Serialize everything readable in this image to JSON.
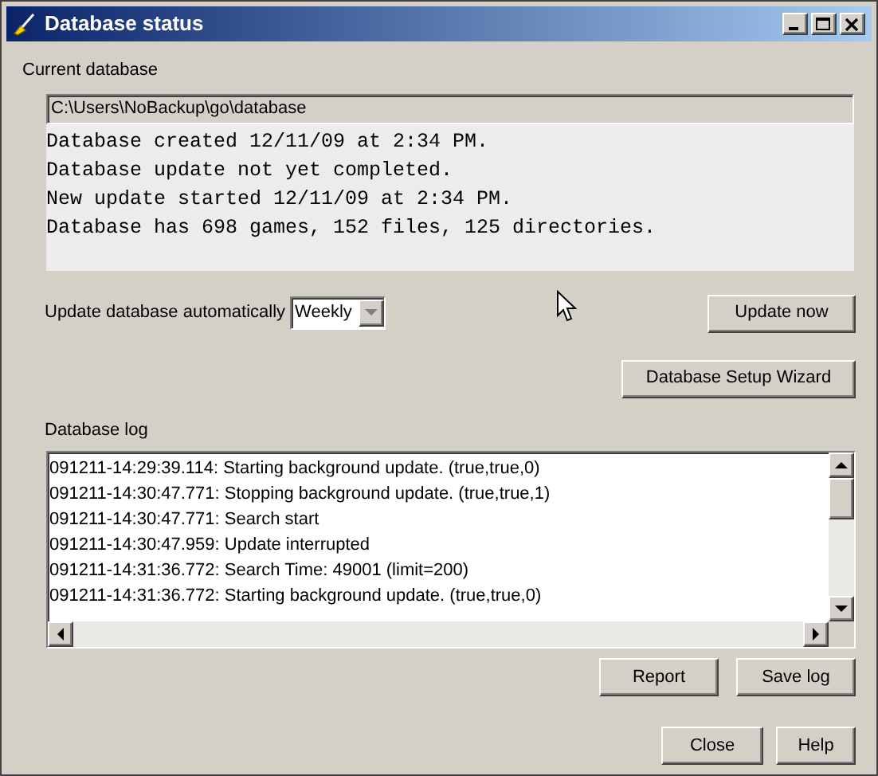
{
  "window": {
    "title": "Database status"
  },
  "current_database": {
    "label": "Current database",
    "path": "C:\\Users\\NoBackup\\go\\database",
    "info_lines": [
      "Database created 12/11/09 at 2:34 PM.",
      "Database update not yet completed.",
      "New update started 12/11/09 at 2:34 PM.",
      "Database has 698 games, 152 files, 125 directories."
    ]
  },
  "auto_update": {
    "label": "Update database automatically",
    "value": "Weekly"
  },
  "update_button": "Update now",
  "wizard_button": "Database Setup Wizard",
  "log": {
    "label": "Database log",
    "lines": [
      "091211-14:29:39.114: Starting background update. (true,true,0)",
      "091211-14:30:47.771: Stopping background update. (true,true,1)",
      "091211-14:30:47.771: Search start",
      "091211-14:30:47.959: Update interrupted",
      "091211-14:31:36.772: Search Time: 49001 (limit=200)",
      "091211-14:31:36.772: Starting background update. (true,true,0)"
    ]
  },
  "log_buttons": [
    "Report",
    "Save log"
  ],
  "footer_buttons": [
    "Close",
    "Help"
  ]
}
